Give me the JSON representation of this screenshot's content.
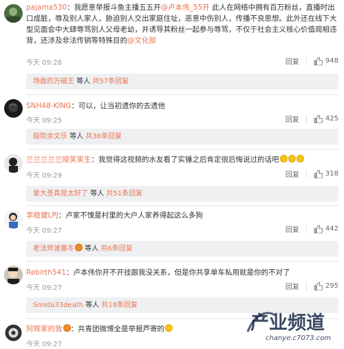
{
  "comments": [
    {
      "username": "pajama530",
      "text": "：我愿意举报斗鱼主播五五开",
      "mention1": "@卢本伟_55开",
      "text2": " 此人在网络中拥有百万粉丝，直播时出口成脏，辱及别人家人，胁迫别人交出家庭住址，恶意中伤别人，传播不良思想。此外还在线下大型见面会中大肆辱骂别人父母老幼，并诱导其粉丝一起参与辱骂，不仅于社会主义核心价值观相违背，还涉及非法传销等特殊目的",
      "mention2": "@文化部",
      "time": "今天 09:28",
      "reply": "回复",
      "likes": "948",
      "sub_user": "场面的万磁王",
      "sub_mid": " 等人 ",
      "sub_count": "共57条回复"
    },
    {
      "username": "SNH48-KING",
      "text": "：可以，让当初遗你的去遗他",
      "time": "今天 09:25",
      "reply": "回复",
      "likes": "425",
      "sub_user": "船院余文乐",
      "sub_mid": " 等人 ",
      "sub_count": "共36条回复"
    },
    {
      "username": "兰兰兰兰兰陵笑笑生",
      "text": "：我觉得这视频的水友看了实锤之后肯定很后悔说过的话吧",
      "time": "今天 09:29",
      "reply": "回复",
      "likes": "318",
      "sub_user": "爱大圣真是太好了",
      "sub_mid": " 等人 ",
      "sub_count": "共51条回复"
    },
    {
      "username": "李稳健LPJ",
      "text": "：卢家不愧是村里的大户人家养得起这么多狗",
      "time": "今天 09:27",
      "reply": "回复",
      "likes": "442",
      "sub_user": "老法师波塞冬",
      "sub_mid": " 等人 ",
      "sub_count": "共6条回复"
    },
    {
      "username": "Rebirth541",
      "text": "：卢本伟你开不开挂跟我没关系，但是你共享单车私用就是你的不对了",
      "time": "今天 09:27",
      "reply": "回复",
      "likes": "295",
      "sub_user": "Smida33death",
      "sub_mid": " 等人 ",
      "sub_count": "共18条回复"
    },
    {
      "username": "阿辉家的我",
      "text": "：共青团微博全是举报芦寄的",
      "time": "今天 09:27"
    }
  ],
  "watermark": {
    "title": "产业频道",
    "url": "chanye.c7073.com"
  },
  "colors": {
    "accent": "#eb7350",
    "subbar_bg": "#eef0f2"
  }
}
